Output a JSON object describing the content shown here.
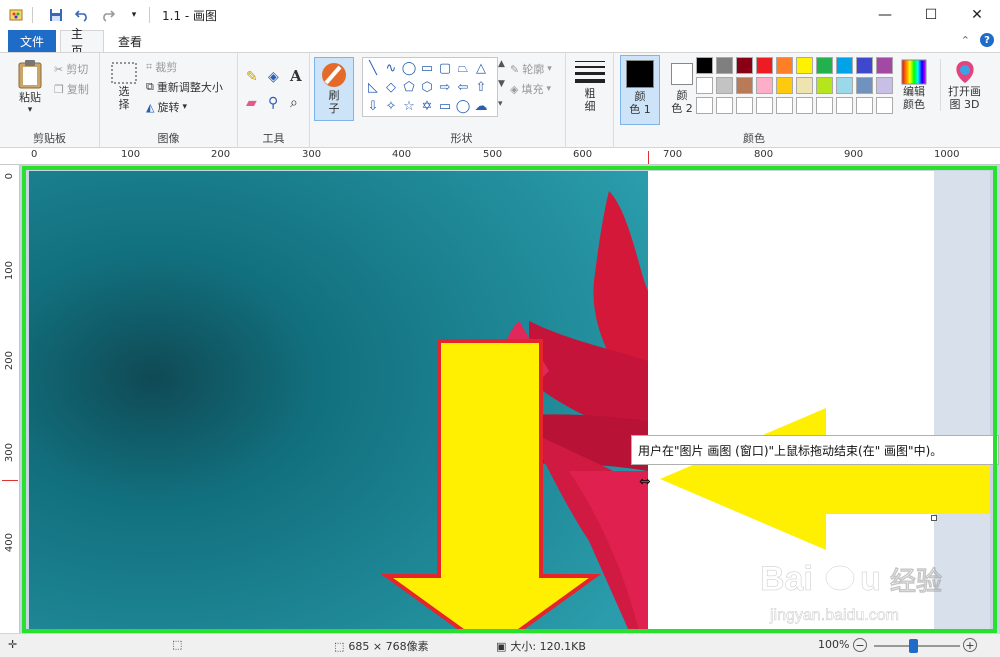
{
  "window": {
    "title": "1.1 - 画图",
    "controls": {
      "minimize": "—",
      "maximize": "☐",
      "close": "✕"
    }
  },
  "tabs": {
    "file": "文件",
    "home": "主页",
    "view": "查看",
    "collapse": "⌃",
    "help": "?"
  },
  "ribbon": {
    "clipboard": {
      "label": "剪贴板",
      "paste": "粘贴",
      "cut": "剪切",
      "copy": "复制"
    },
    "image": {
      "label": "图像",
      "select": "选\n择",
      "crop": "裁剪",
      "resize": "重新调整大小",
      "rotate": "旋转"
    },
    "tools": {
      "label": "工具"
    },
    "brushes": {
      "label": "刷\n子"
    },
    "shapes": {
      "label": "形状",
      "outline": "轮廓",
      "fill": "填充"
    },
    "size": {
      "label": "粗\n细"
    },
    "colors": {
      "label": "颜色",
      "color1": "颜\n色 1",
      "color2": "颜\n色 2",
      "edit": "编辑\n颜色",
      "paint3d": "打开画\n图 3D",
      "palette_row1": [
        "#000000",
        "#7f7f7f",
        "#880015",
        "#ed1c24",
        "#ff7f27",
        "#fff200",
        "#22b14c",
        "#00a2e8",
        "#3f48cc",
        "#a349a4"
      ],
      "palette_row2": [
        "#ffffff",
        "#c3c3c3",
        "#b97a57",
        "#ffaec9",
        "#ffc90e",
        "#efe4b0",
        "#b5e61d",
        "#99d9ea",
        "#7092be",
        "#c8bfe7"
      ]
    }
  },
  "ruler": {
    "top": [
      "0",
      "100",
      "200",
      "300",
      "400",
      "500",
      "600",
      "700",
      "800",
      "900",
      "1000"
    ],
    "left": [
      "0",
      "100",
      "200",
      "300",
      "400"
    ]
  },
  "tooltip": "用户在\"图片 画图 (窗口)\"上鼠标拖动结束(在\" 画图\"中)。",
  "status": {
    "dimensions": "685 × 768像素",
    "size": "大小: 120.1KB",
    "zoom": "100%"
  }
}
